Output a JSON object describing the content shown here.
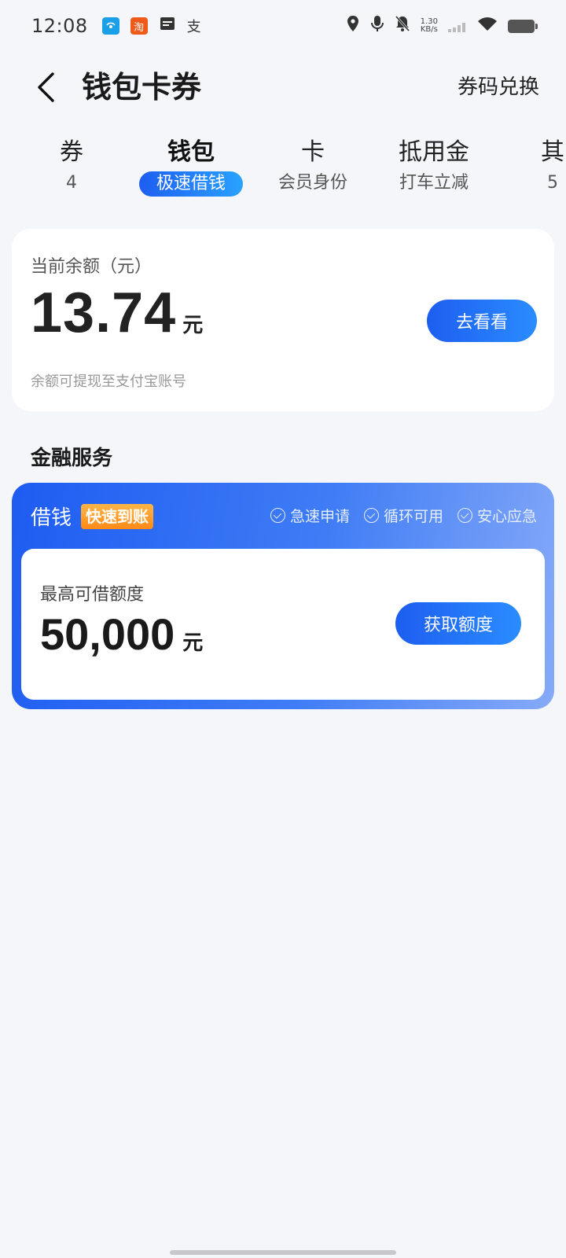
{
  "status_bar": {
    "time": "12:08",
    "net_speed_value": "1.30",
    "net_speed_unit": "KB/s",
    "app_icons": [
      {
        "name": "app-icon-1",
        "glyph": "📶",
        "color": "#1aa0e8"
      },
      {
        "name": "taobao-icon",
        "glyph": "淘",
        "color": "#f05a1a"
      },
      {
        "name": "calendar-icon",
        "glyph": "▤",
        "color": "#333333"
      },
      {
        "name": "alipay-icon",
        "glyph": "支",
        "color": "#333333"
      }
    ]
  },
  "header": {
    "title": "钱包卡券",
    "redeem_label": "券码兑换"
  },
  "tabs": [
    {
      "label": "券",
      "sub": "4"
    },
    {
      "label": "钱包",
      "sub": "极速借钱"
    },
    {
      "label": "卡",
      "sub": "会员身份"
    },
    {
      "label": "抵用金",
      "sub": "打车立减"
    },
    {
      "label": "其",
      "sub": "5"
    }
  ],
  "balance": {
    "label": "当前余额（元）",
    "amount": "13.74",
    "unit": "元",
    "note": "余额可提现至支付宝账号",
    "button_label": "去看看"
  },
  "finance": {
    "section_title": "金融服务",
    "loan_title": "借钱",
    "loan_tag": "快速到账",
    "features": [
      "急速申请",
      "循环可用",
      "安心应急"
    ],
    "limit_label": "最高可借额度",
    "limit_amount": "50,000",
    "limit_unit": "元",
    "button_label": "获取额度"
  },
  "colors": {
    "accent": "#1d5ef0",
    "tag_orange": "#ff9a26",
    "background": "#f4f6f9"
  }
}
